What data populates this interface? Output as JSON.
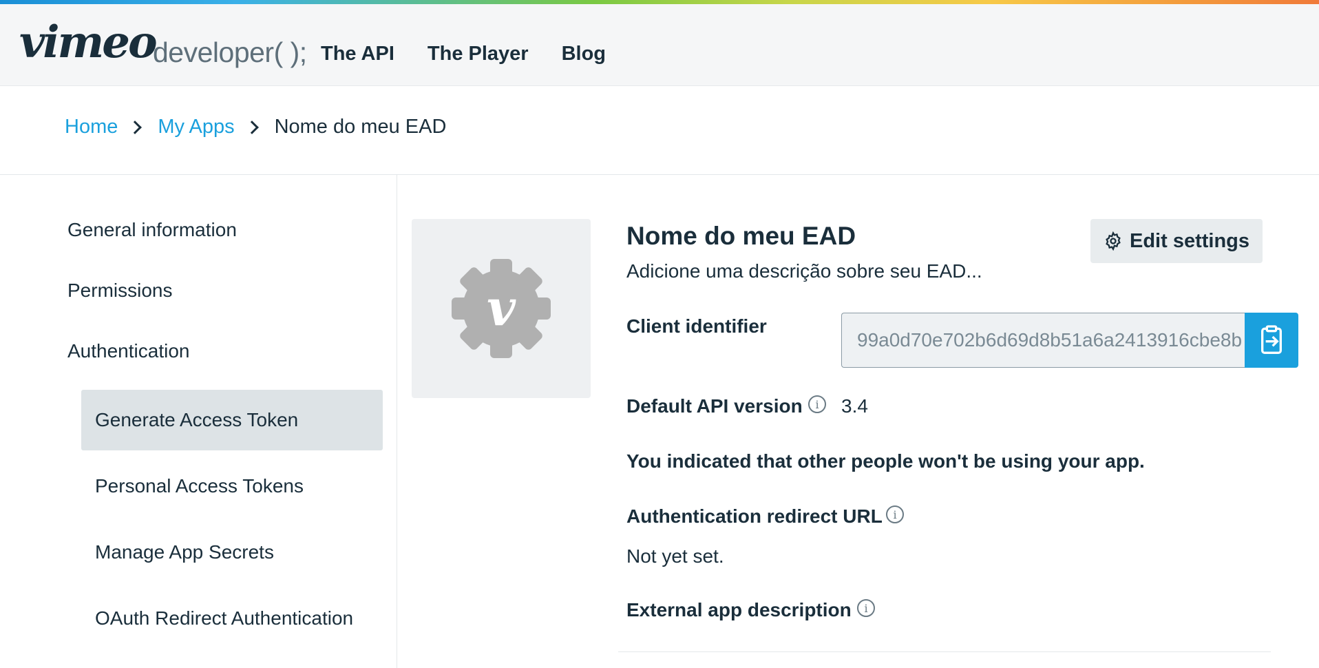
{
  "colors": {
    "accent": "#1aa0dd",
    "text": "#1a2e3b",
    "active_bg": "#dde3e6"
  },
  "header": {
    "logo_text": "vimeo",
    "developer_text": "developer( );",
    "nav": [
      {
        "label": "The API"
      },
      {
        "label": "The Player"
      },
      {
        "label": "Blog"
      }
    ]
  },
  "breadcrumb": {
    "items": [
      {
        "label": "Home"
      },
      {
        "label": "My Apps"
      },
      {
        "label": "Nome do meu EAD"
      }
    ]
  },
  "sidebar": {
    "items": [
      {
        "label": "General information"
      },
      {
        "label": "Permissions"
      },
      {
        "label": "Authentication"
      }
    ],
    "subitems": [
      {
        "label": "Generate Access Token",
        "active": true
      },
      {
        "label": "Personal Access Tokens"
      },
      {
        "label": "Manage App Secrets"
      },
      {
        "label": "OAuth Redirect Authentication"
      }
    ]
  },
  "app": {
    "thumbnail_icon": "vimeo-gear-icon",
    "title": "Nome do meu EAD",
    "description": "Adicione uma descrição sobre seu EAD...",
    "edit_button": "Edit settings",
    "edit_icon": "gear-icon",
    "client_identifier_label": "Client identifier",
    "client_identifier_value": "99a0d70e702b6d69d8b51a6a2413916cbe8b",
    "copy_icon": "clipboard-icon",
    "api_version_label": "Default API version",
    "api_version_value": "3.4",
    "usage_note": "You indicated that other people won't be using your app.",
    "redirect_label": "Authentication redirect URL",
    "redirect_value": "Not yet set.",
    "external_desc_label": "External app description",
    "info_icon": "info-icon"
  }
}
